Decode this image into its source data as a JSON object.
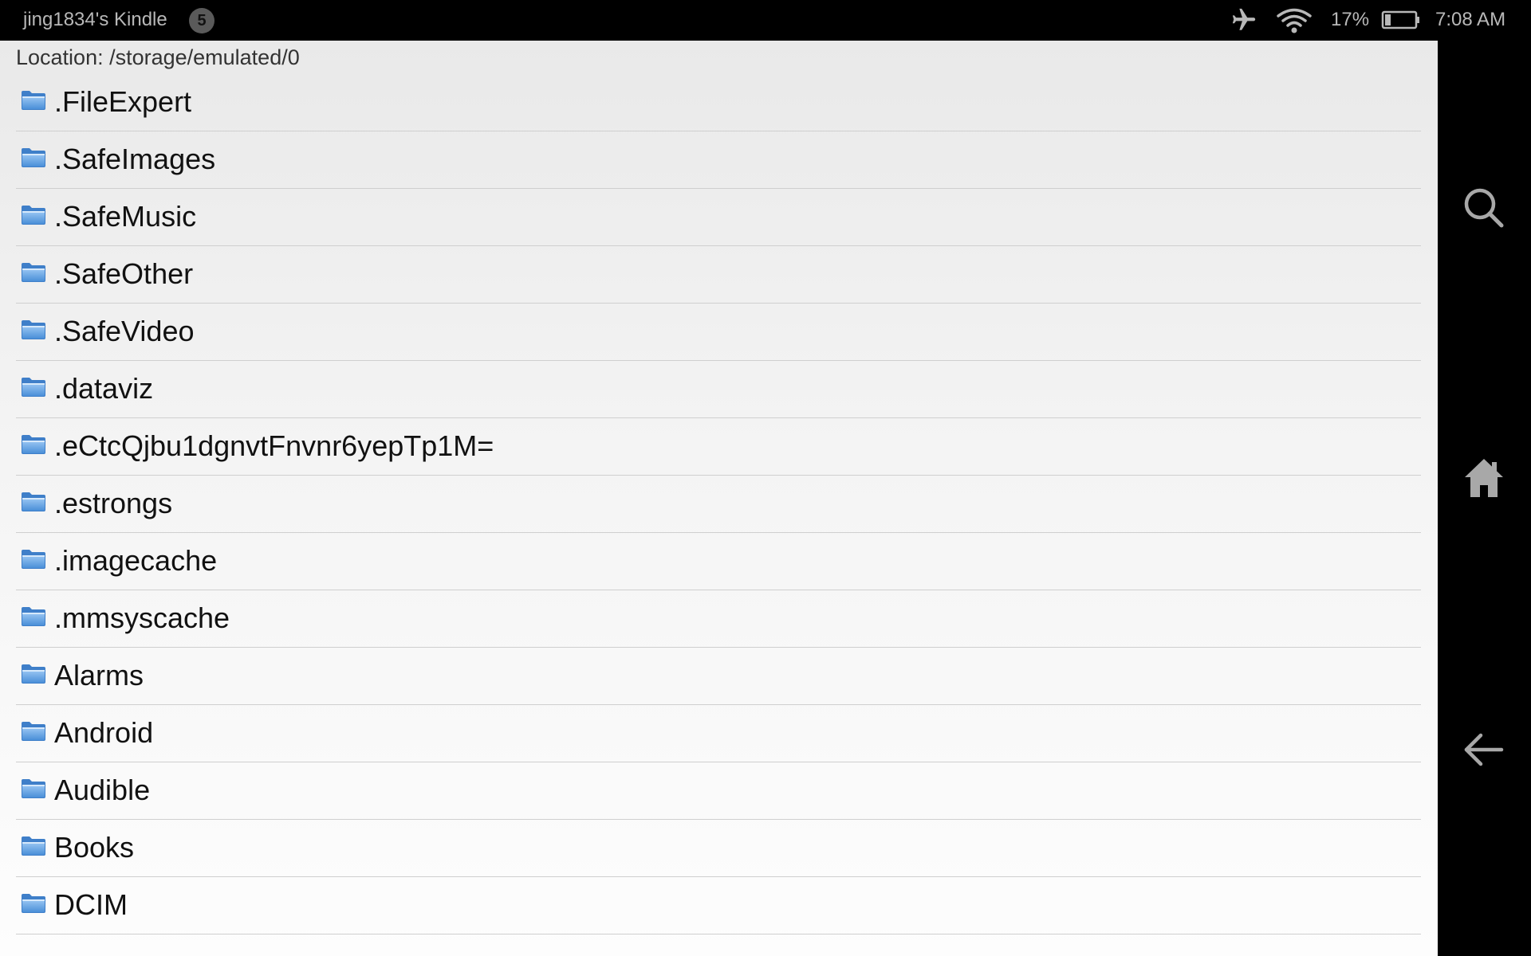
{
  "status_bar": {
    "device_name": "jing1834's Kindle",
    "notification_count": "5",
    "battery_percent": "17%",
    "time": "7:08 AM",
    "icons": [
      "airplane-mode-icon",
      "wifi-icon",
      "battery-icon"
    ]
  },
  "location": {
    "text": "Location: /storage/emulated/0"
  },
  "files": [
    {
      "name": ".FileExpert",
      "type": "folder"
    },
    {
      "name": ".SafeImages",
      "type": "folder"
    },
    {
      "name": ".SafeMusic",
      "type": "folder"
    },
    {
      "name": ".SafeOther",
      "type": "folder"
    },
    {
      "name": ".SafeVideo",
      "type": "folder"
    },
    {
      "name": ".dataviz",
      "type": "folder"
    },
    {
      "name": ".eCtcQjbu1dgnvtFnvnr6yepTp1M=",
      "type": "folder"
    },
    {
      "name": ".estrongs",
      "type": "folder"
    },
    {
      "name": ".imagecache",
      "type": "folder"
    },
    {
      "name": ".mmsyscache",
      "type": "folder"
    },
    {
      "name": "Alarms",
      "type": "folder"
    },
    {
      "name": "Android",
      "type": "folder"
    },
    {
      "name": "Audible",
      "type": "folder"
    },
    {
      "name": "Books",
      "type": "folder"
    },
    {
      "name": "DCIM",
      "type": "folder"
    }
  ],
  "nav_bar": {
    "icons": [
      "search-icon",
      "home-icon",
      "back-arrow-icon"
    ]
  },
  "colors": {
    "status_bar_bg": "#000000",
    "status_text": "#b8b8b8",
    "folder_blue": "#5b9be0",
    "divider": "#cfcfcf"
  }
}
